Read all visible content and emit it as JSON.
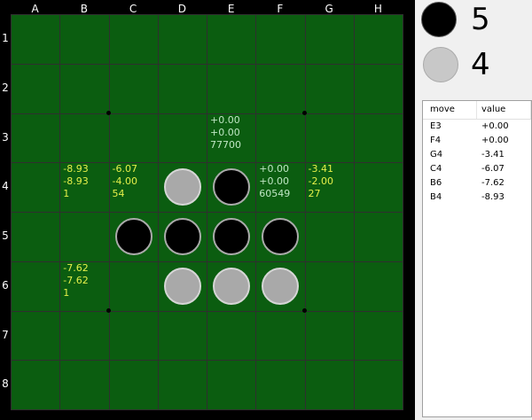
{
  "board": {
    "columns": [
      "A",
      "B",
      "C",
      "D",
      "E",
      "F",
      "G",
      "H"
    ],
    "rows": [
      "1",
      "2",
      "3",
      "4",
      "5",
      "6",
      "7",
      "8"
    ],
    "discs": [
      {
        "cell": "D4",
        "color": "white"
      },
      {
        "cell": "E4",
        "color": "black"
      },
      {
        "cell": "C5",
        "color": "black"
      },
      {
        "cell": "D5",
        "color": "black"
      },
      {
        "cell": "E5",
        "color": "black"
      },
      {
        "cell": "F5",
        "color": "black"
      },
      {
        "cell": "D6",
        "color": "white"
      },
      {
        "cell": "E6",
        "color": "white"
      },
      {
        "cell": "F6",
        "color": "white"
      }
    ],
    "evaluations": [
      {
        "cell": "E3",
        "lines": [
          "+0.00",
          "+0.00",
          "77700"
        ],
        "style": "best"
      },
      {
        "cell": "F4",
        "lines": [
          "+0.00",
          "+0.00",
          "60549"
        ],
        "style": "best"
      },
      {
        "cell": "B4",
        "lines": [
          "-8.93",
          "-8.93",
          "1"
        ],
        "style": "other"
      },
      {
        "cell": "C4",
        "lines": [
          "-6.07",
          "-4.00",
          "54"
        ],
        "style": "other"
      },
      {
        "cell": "G4",
        "lines": [
          "-3.41",
          "-2.00",
          "27"
        ],
        "style": "other"
      },
      {
        "cell": "B6",
        "lines": [
          "-7.62",
          "-7.62",
          "1"
        ],
        "style": "other"
      }
    ]
  },
  "score": {
    "black": "5",
    "white": "4"
  },
  "move_list": {
    "headers": {
      "move": "move",
      "value": "value"
    },
    "rows": [
      {
        "move": "E3",
        "value": "+0.00"
      },
      {
        "move": "F4",
        "value": "+0.00"
      },
      {
        "move": "G4",
        "value": "-3.41"
      },
      {
        "move": "C4",
        "value": "-6.07"
      },
      {
        "move": "B6",
        "value": "-7.62"
      },
      {
        "move": "B4",
        "value": "-8.93"
      }
    ]
  }
}
